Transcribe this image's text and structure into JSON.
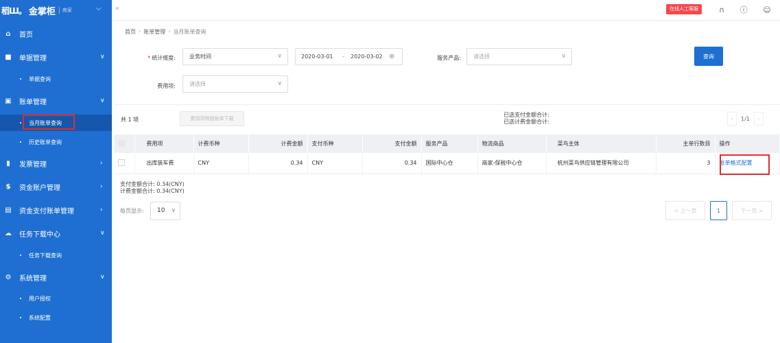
{
  "app": {
    "logo_mark": "稻Ш。",
    "name": "金掌柜",
    "sub": "商家"
  },
  "sidebar": {
    "items": [
      {
        "label": "首页",
        "icon": "home-icon"
      },
      {
        "label": "单据管理",
        "icon": "document-icon"
      },
      {
        "label": "单据查询"
      },
      {
        "label": "账单管理",
        "icon": "bill-icon"
      },
      {
        "label": "当月账单查询"
      },
      {
        "label": "历史账单查询"
      },
      {
        "label": "发票管理",
        "icon": "invoice-icon"
      },
      {
        "label": "资金账户管理",
        "icon": "dollar-icon"
      },
      {
        "label": "资金支付账单管理",
        "icon": "payment-icon"
      },
      {
        "label": "任务下载中心",
        "icon": "cloud-icon"
      },
      {
        "label": "任务下载查询"
      },
      {
        "label": "系统管理",
        "icon": "gear-icon"
      },
      {
        "label": "用户授权"
      },
      {
        "label": "系统配置"
      }
    ]
  },
  "topbar": {
    "customer_service": "在线人工客服"
  },
  "breadcrumb": {
    "home": "首页",
    "section": "账单管理",
    "current": "当月账单查询"
  },
  "filters": {
    "dimension_label": "统计维度:",
    "dimension_value": "业务时间",
    "date_start": "2020-03-01",
    "date_sep": "-",
    "date_end": "2020-03-02",
    "service_label": "服务产品:",
    "service_placeholder": "请选择",
    "fee_label": "费用项:",
    "fee_placeholder": "请选择",
    "query_button": "查询"
  },
  "toolbar": {
    "total": "共 1 项",
    "download_button": "费用项明细账单下载",
    "selected_pay_total": "已选支付金额合计:",
    "selected_fee_total": "已选计费金额合计:",
    "page_indicator": "1/1"
  },
  "table": {
    "headers": [
      "费用项",
      "计费币种",
      "计费金额",
      "支付币种",
      "支付金额",
      "服务产品",
      "物流商品",
      "菜鸟主体",
      "主单行数目",
      "操作"
    ],
    "rows": [
      {
        "fee_item": "出库装车费",
        "fee_currency": "CNY",
        "fee_amount": "0.34",
        "pay_currency": "CNY",
        "pay_amount": "0.34",
        "service_product": "国际中心仓",
        "logistics_product": "商家-保税中心仓",
        "cainiao_entity": "杭州菜鸟供应链管理有限公司",
        "line_count": "3",
        "action": "账单格式配置"
      }
    ]
  },
  "footer": {
    "pay_total": "支付金额合计:  0.34(CNY)",
    "fee_total": "计费金额合计:  0.34(CNY)",
    "per_page_label": "每页显示:",
    "per_page_value": "10",
    "prev": "< 上一页",
    "page": "1",
    "next": "下一页 >"
  }
}
